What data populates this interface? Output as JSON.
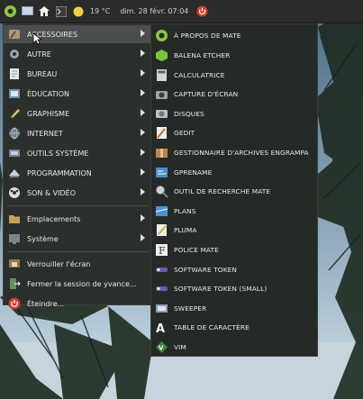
{
  "panel": {
    "weather": "19 °C",
    "datetime": "dim. 28 févr. 07:04"
  },
  "menu": {
    "items": [
      {
        "label": "ACCESSOIRES",
        "icon": "accessories-icon",
        "submenu": true,
        "active": true
      },
      {
        "label": "AUTRE",
        "icon": "gear-icon",
        "submenu": true
      },
      {
        "label": "BUREAU",
        "icon": "office-icon",
        "submenu": true
      },
      {
        "label": "ÉDUCATION",
        "icon": "education-icon",
        "submenu": true
      },
      {
        "label": "GRAPHISME",
        "icon": "graphics-icon",
        "submenu": true
      },
      {
        "label": "INTERNET",
        "icon": "globe-icon",
        "submenu": true
      },
      {
        "label": "OUTILS SYSTÈME",
        "icon": "system-tools-icon",
        "submenu": true
      },
      {
        "label": "PROGRAMMATION",
        "icon": "programming-icon",
        "submenu": true
      },
      {
        "label": "SON & VIDÉO",
        "icon": "multimedia-icon",
        "submenu": true
      }
    ],
    "places": [
      {
        "label": "Emplacements",
        "icon": "folder-icon",
        "submenu": true
      },
      {
        "label": "Système",
        "icon": "system-icon",
        "submenu": true
      }
    ],
    "actions": [
      {
        "label": "Verrouiller l'écran",
        "icon": "lock-screen-icon"
      },
      {
        "label": "Fermer la session de yvance...",
        "icon": "logout-icon"
      },
      {
        "label": "Éteindre...",
        "icon": "power-icon"
      }
    ]
  },
  "submenu": {
    "items": [
      {
        "label": "À PROPOS DE MATE",
        "icon": "mate-icon"
      },
      {
        "label": "BALENA ETCHER",
        "icon": "etcher-icon"
      },
      {
        "label": "CALCULATRICE",
        "icon": "calculator-icon"
      },
      {
        "label": "CAPTURE D'ÉCRAN",
        "icon": "screenshot-icon"
      },
      {
        "label": "DISQUES",
        "icon": "disks-icon"
      },
      {
        "label": "GEDIT",
        "icon": "gedit-icon"
      },
      {
        "label": "GESTIONNAIRE D'ARCHIVES ENGRAMPA",
        "icon": "archive-icon"
      },
      {
        "label": "GPRENAME",
        "icon": "gprename-icon"
      },
      {
        "label": "OUTIL DE RECHERCHE MATE",
        "icon": "search-icon"
      },
      {
        "label": "PLANS",
        "icon": "maps-icon"
      },
      {
        "label": "PLUMA",
        "icon": "pluma-icon"
      },
      {
        "label": "POLICE MATE",
        "icon": "font-icon"
      },
      {
        "label": "SOFTWARE TOKEN",
        "icon": "token-icon"
      },
      {
        "label": "SOFTWARE TOKEN (SMALL)",
        "icon": "token-small-icon"
      },
      {
        "label": "SWEEPER",
        "icon": "sweeper-icon"
      },
      {
        "label": "TABLE DE CARACTÈRE",
        "icon": "charmap-icon"
      },
      {
        "label": "VIM",
        "icon": "vim-icon"
      }
    ]
  }
}
